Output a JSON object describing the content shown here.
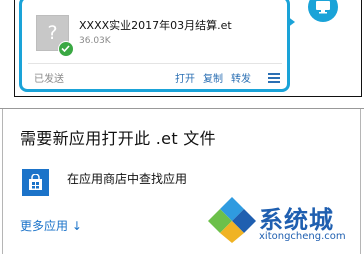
{
  "file_card": {
    "file_icon_glyph": "?",
    "file_name": "XXXX实业2017年03月结算.et",
    "file_size": "36.03K",
    "status": "已发送",
    "actions": {
      "open": "打开",
      "copy": "复制",
      "forward": "转发"
    },
    "accent_color": "#1aa3d8"
  },
  "open_with_dialog": {
    "title": "需要新应用打开此 .et 文件",
    "store_option": "在应用商店中查找应用",
    "more_apps": "更多应用 ↓",
    "accent_color": "#1b73c9"
  },
  "watermark": {
    "name": "系统城",
    "url": "xitongcheng.com"
  },
  "icons": [
    "file-placeholder-icon",
    "check-icon",
    "menu-icon",
    "monitor-icon",
    "store-bag-icon",
    "watermark-logo-icon"
  ]
}
